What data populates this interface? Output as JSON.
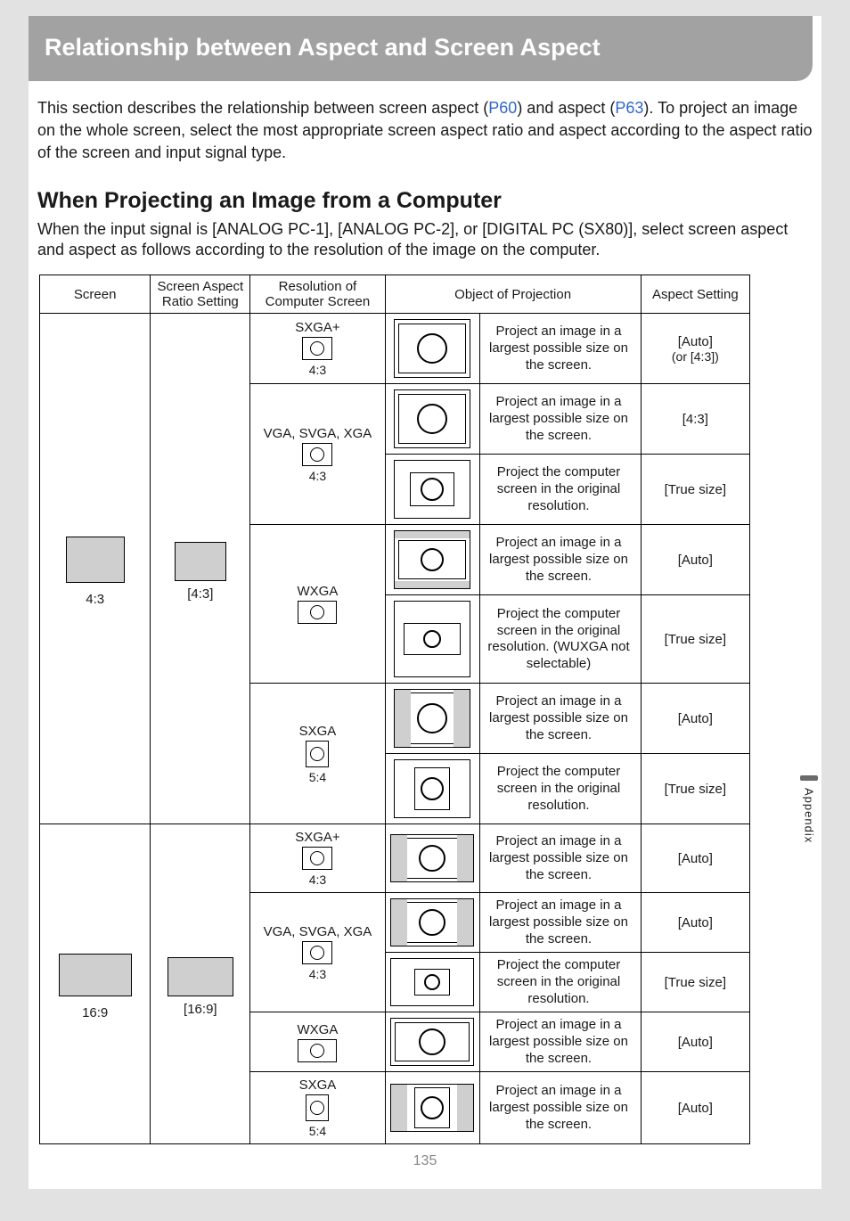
{
  "title": "Relationship between Aspect and Screen Aspect",
  "intro_p1a": "This section describes the relationship between screen aspect (",
  "intro_link1": "P60",
  "intro_p1b": ") and aspect (",
  "intro_link2": "P63",
  "intro_p1c": ").",
  "intro_p2": "To project an image on the whole screen, select the most appropriate screen aspect ratio and aspect according to the aspect ratio of the screen and input signal type.",
  "subhead": "When Projecting an Image from a Computer",
  "subintro": "When the input signal is [ANALOG PC-1], [ANALOG PC-2], or [DIGITAL PC (SX80)], select screen aspect and aspect as follows according to the resolution of the image on the computer.",
  "headers": {
    "screen": "Screen",
    "ratio": "Screen Aspect Ratio Setting",
    "res": "Resolution of Computer Screen",
    "obj": "Object of Projection",
    "aspect": "Aspect Setting"
  },
  "screens": {
    "s43": "4:3",
    "s169": "16:9"
  },
  "ratios": {
    "r43": "[4:3]",
    "r169": "[16:9]"
  },
  "res": {
    "sxgap": "SXGA+",
    "vga": "VGA, SVGA, XGA",
    "wxga": "WXGA",
    "sxga": "SXGA",
    "r43": "4:3",
    "r54": "5:4"
  },
  "obj": {
    "largest": "Project an image in a largest possible size on the screen.",
    "original": "Project the computer screen in the original resolution.",
    "original_nowuxga": "Project the computer screen in the original resolution. (WUXGA not selectable)"
  },
  "aspect": {
    "auto": "[Auto]",
    "or43": "(or [4:3])",
    "a43": "[4:3]",
    "truesize": "[True size]"
  },
  "pagenum": "135",
  "appendix": "Appendix"
}
